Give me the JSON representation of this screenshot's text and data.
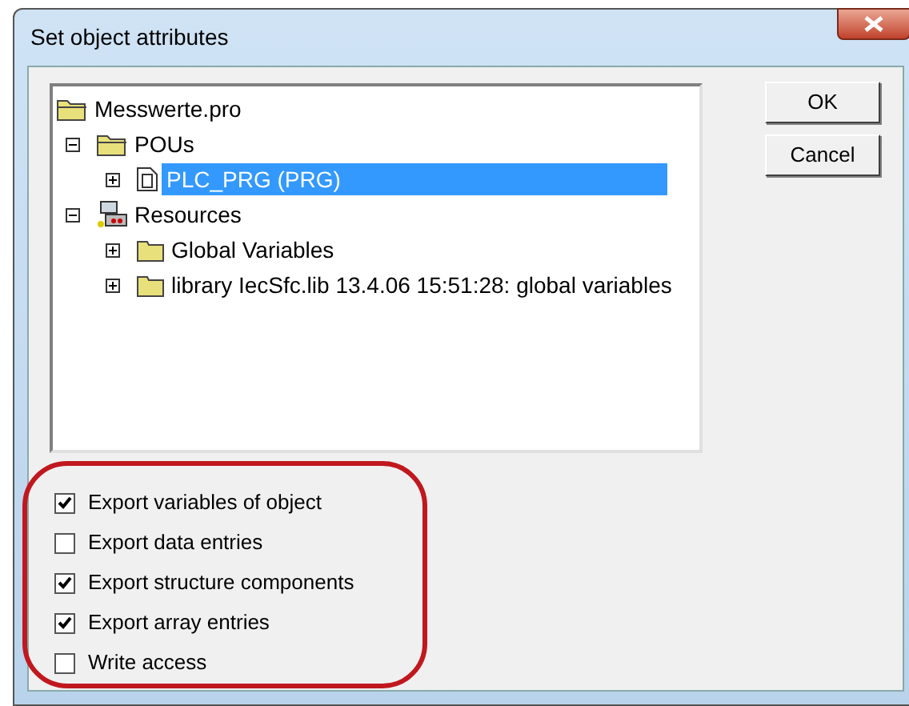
{
  "window": {
    "title": "Set object attributes"
  },
  "tree": [
    {
      "label": "Messwerte.pro",
      "kind": "project",
      "selected": false,
      "children": [
        {
          "label": "POUs",
          "kind": "folder-open",
          "expanded": true,
          "selected": false,
          "children": [
            {
              "label": "PLC_PRG (PRG)",
              "kind": "pou",
              "expanded": false,
              "selected": true
            }
          ]
        },
        {
          "label": "Resources",
          "kind": "resources",
          "expanded": true,
          "selected": false,
          "children": [
            {
              "label": "Global Variables",
              "kind": "folder",
              "expanded": false,
              "selected": false
            },
            {
              "label": "library IecSfc.lib 13.4.06 15:51:28: global variables",
              "kind": "folder",
              "expanded": false,
              "selected": false
            }
          ]
        }
      ]
    }
  ],
  "buttons": [
    "OK",
    "Cancel"
  ],
  "options": [
    {
      "label": "Export variables of object",
      "checked": true
    },
    {
      "label": "Export data entries",
      "checked": false
    },
    {
      "label": "Export structure components",
      "checked": true
    },
    {
      "label": "Export array entries",
      "checked": true
    },
    {
      "label": "Write access",
      "checked": false
    }
  ]
}
